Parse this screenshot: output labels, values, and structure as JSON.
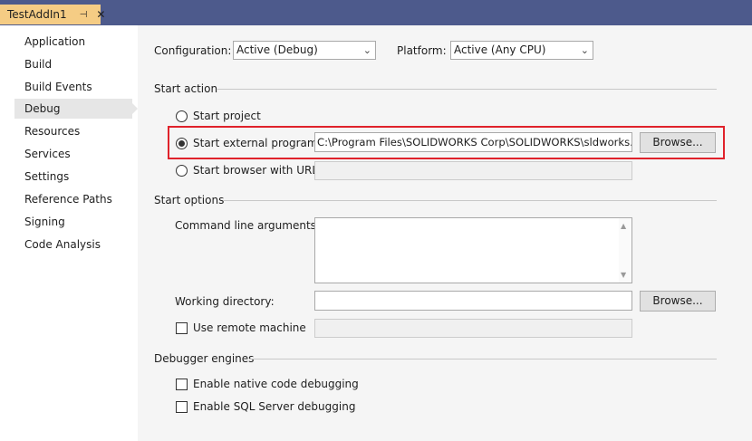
{
  "tab": {
    "title": "TestAddIn1",
    "pin": "⊣",
    "close": "✕"
  },
  "sidebar": {
    "items": [
      {
        "label": "Application"
      },
      {
        "label": "Build"
      },
      {
        "label": "Build Events"
      },
      {
        "label": "Debug"
      },
      {
        "label": "Resources"
      },
      {
        "label": "Services"
      },
      {
        "label": "Settings"
      },
      {
        "label": "Reference Paths"
      },
      {
        "label": "Signing"
      },
      {
        "label": "Code Analysis"
      }
    ],
    "active": "Debug"
  },
  "config": {
    "configuration_label": "Configuration:",
    "configuration_value": "Active (Debug)",
    "platform_label": "Platform:",
    "platform_value": "Active (Any CPU)"
  },
  "start_action": {
    "header": "Start action",
    "start_project": "Start project",
    "start_external": "Start external program:",
    "external_path": "C:\\Program Files\\SOLIDWORKS Corp\\SOLIDWORKS\\sldworks.exe",
    "browse_label": "Browse...",
    "start_browser": "Start browser with URL:",
    "browser_url": "",
    "selected": "start_external"
  },
  "start_options": {
    "header": "Start options",
    "cmd_args_label": "Command line arguments:",
    "cmd_args_value": "",
    "working_dir_label": "Working directory:",
    "working_dir_value": "",
    "browse_label": "Browse...",
    "remote_label": "Use remote machine",
    "remote_value": "",
    "remote_checked": false
  },
  "debugger_engines": {
    "header": "Debugger engines",
    "native_label": "Enable native code debugging",
    "native_checked": false,
    "sql_label": "Enable SQL Server debugging",
    "sql_checked": false
  },
  "icons": {
    "chevron": "chevron-down-icon",
    "scroll_up": "scroll-up-icon",
    "scroll_down": "scroll-down-icon"
  },
  "colors": {
    "highlight": "#e0222b",
    "tab": "#f5cc84",
    "frame": "#4d5a8c"
  }
}
